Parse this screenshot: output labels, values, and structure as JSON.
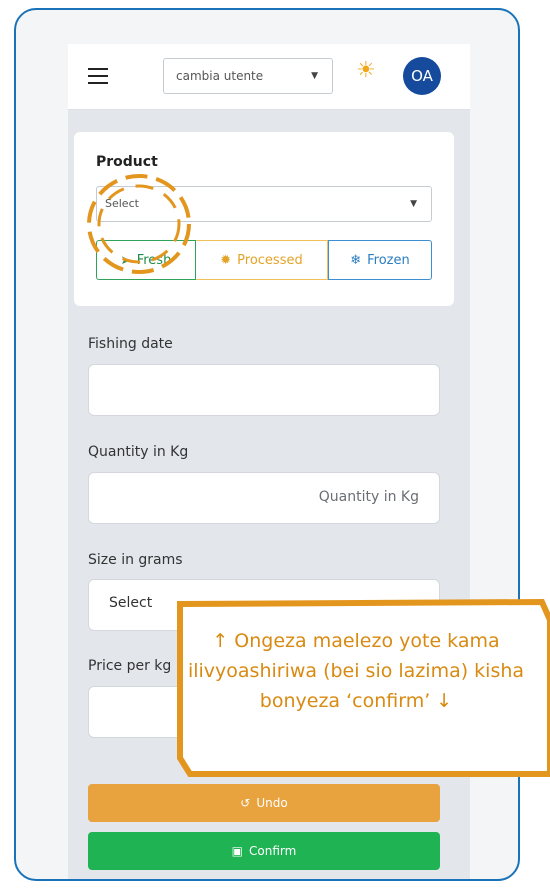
{
  "header": {
    "user_select_value": "cambia utente",
    "avatar_initials": "OA"
  },
  "product": {
    "label": "Product",
    "select_value": "Select",
    "options": [
      {
        "label": "Fresh",
        "icon": "fish-icon",
        "color": "#1f8a47"
      },
      {
        "label": "Processed",
        "icon": "gear-icon",
        "color": "#e3a326"
      },
      {
        "label": "Frozen",
        "icon": "snowflake-icon",
        "color": "#2a7dc0"
      }
    ]
  },
  "form": {
    "fishing_date_label": "Fishing date",
    "fishing_date_value": "",
    "quantity_label": "Quantity in Kg",
    "quantity_placeholder": "Quantity in Kg",
    "size_label": "Size in grams",
    "size_value": "Select",
    "price_label": "Price per kg"
  },
  "buttons": {
    "undo_label": "Undo",
    "confirm_label": "Confirm"
  },
  "annotation": {
    "callout_text": "↑ Ongeza maelezo yote kama ilivyoashiriwa (bei sio lazima) kisha bonyeza ‘confirm’ ↓",
    "accent_color": "#e3961e"
  }
}
